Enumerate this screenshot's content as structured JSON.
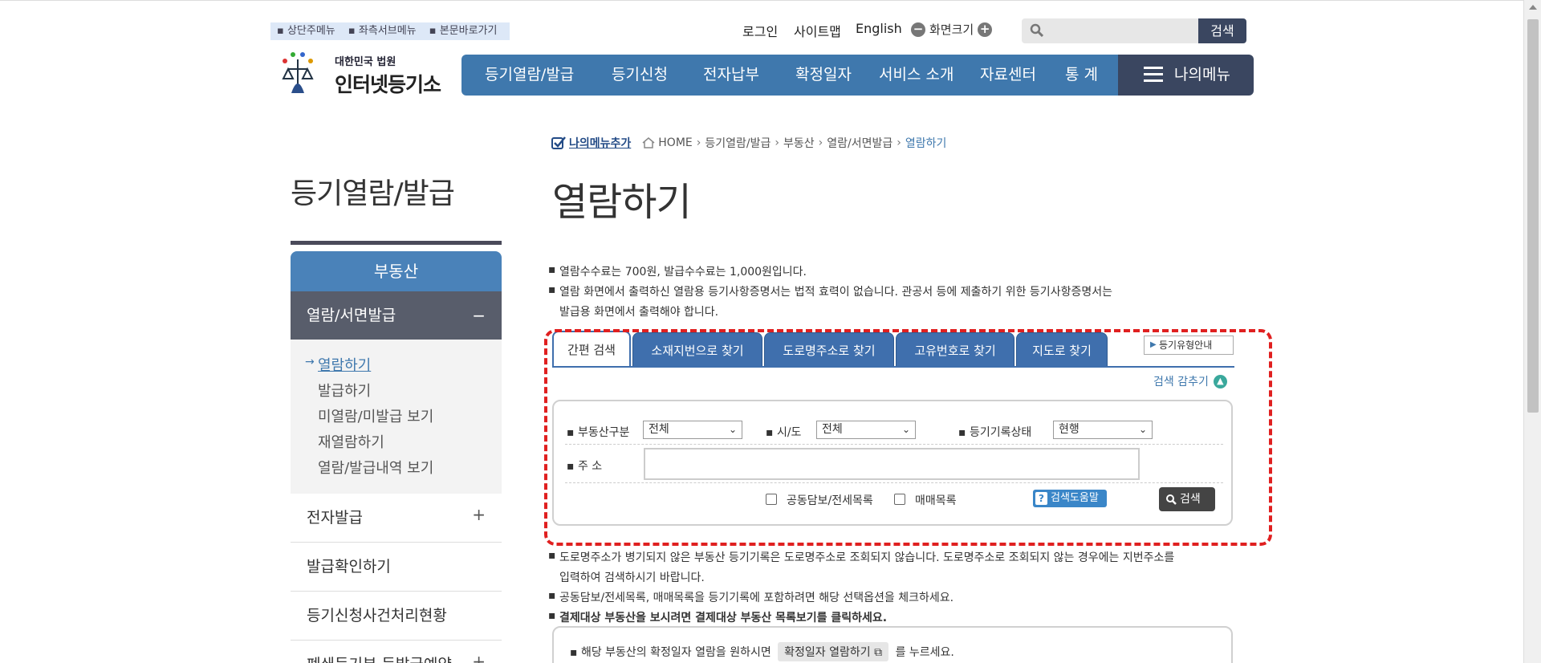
{
  "skipnav": [
    "상단주메뉴",
    "좌측서브메뉴",
    "본문바로가기"
  ],
  "logo": {
    "sub": "대한민국 법원",
    "main": "인터넷등기소"
  },
  "util": {
    "login": "로그인",
    "sitemap": "사이트맵",
    "english": "English",
    "zoom": "화면크기",
    "zoom_minus": "−",
    "zoom_plus": "+"
  },
  "topsearch": {
    "placeholder": "",
    "button": "검색"
  },
  "gnb": [
    "등기열람/발급",
    "등기신청",
    "전자납부",
    "확정일자",
    "서비스 소개",
    "자료센터",
    "통 계"
  ],
  "mymenu": "나의메뉴",
  "sidebar": {
    "title": "등기열람/발급",
    "head": "부동산",
    "active": "열람/서면발급",
    "active_toggle": "−",
    "sub": [
      "열람하기",
      "발급하기",
      "미열람/미발급 보기",
      "재열람하기",
      "열람/발급내역 보기"
    ],
    "sub_arrow": "→",
    "rows": [
      {
        "label": "전자발급",
        "toggle": "+"
      },
      {
        "label": "발급확인하기",
        "toggle": ""
      },
      {
        "label": "등기신청사건처리현황",
        "toggle": ""
      },
      {
        "label": "폐쇄등기부 등발급예약",
        "toggle": "+"
      }
    ]
  },
  "breadcrumb": {
    "addmenu": "나의메뉴추가",
    "items": [
      "HOME",
      "등기열람/발급",
      "부동산",
      "열람/서면발급",
      "열람하기"
    ]
  },
  "page_title": "열람하기",
  "info": [
    "열람수수료는 700원, 발급수수료는 1,000원입니다.",
    "열람 화면에서 출력하신 열람용 등기사항증명서는 법적 효력이 없습니다. 관공서 등에 제출하기 위한 등기사항증명서는",
    "발급용 화면에서 출력해야 합니다."
  ],
  "tabs": [
    "간편 검색",
    "소재지번으로 찾기",
    "도로명주소로 찾기",
    "고유번호로 찾기",
    "지도로 찾기"
  ],
  "guide_button": "등기유형안내",
  "hide_search": "검색 감추기",
  "form": {
    "type_label": "부동산구분",
    "type_value": "전체",
    "sido_label": "시/도",
    "sido_value": "전체",
    "status_label": "등기기록상태",
    "status_value": "현행",
    "address_label": "주 소",
    "address_value": "",
    "chk1": "공동담보/전세목록",
    "chk2": "매매목록",
    "help": "검색도움말",
    "search": "검색"
  },
  "notes": [
    "도로명주소가 병기되지 않은 부동산 등기기록은 도로명주소로 조회되지 않습니다. 도로명주소로 조회되지 않는 경우에는 지번주소를",
    "입력하여 검색하시기 바랍니다.",
    "공동담보/전세목록, 매매목록을 등기기록에 포함하려면 해당 선택옵션을 체크하세요.",
    "결제대상 부동산을 보시려면 결제대상 부동산 목록보기를 클릭하세요."
  ],
  "confirm": {
    "pre": "해당 부동산의 확정일자 열람을 원하시면",
    "button": "확정일자 열람하기",
    "post": "를 누르세요."
  },
  "colors": {
    "primary": "#3f78ad",
    "dark": "#3a4660",
    "annotation": "#e02020"
  }
}
